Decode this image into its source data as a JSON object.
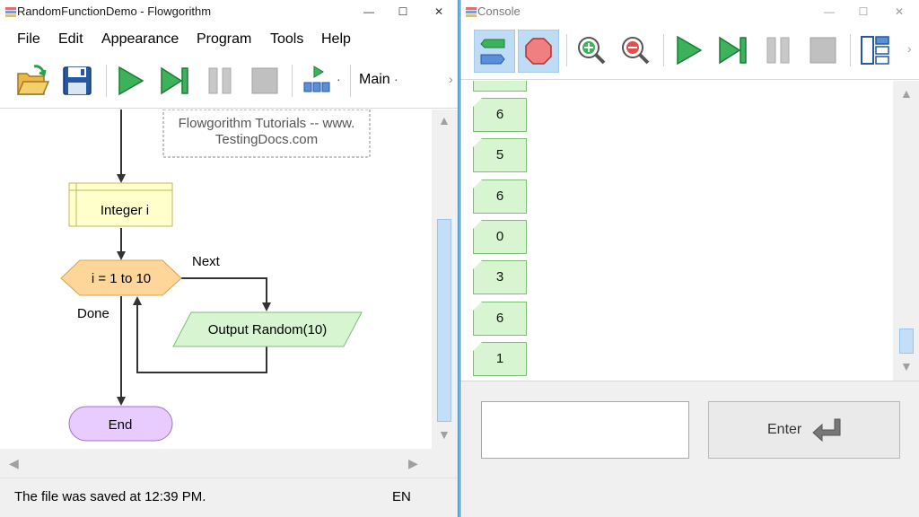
{
  "main_window": {
    "title": "RandomFunctionDemo - Flowgorithm",
    "controls": {
      "minimize": "—",
      "maximize": "☐",
      "close": "✕"
    },
    "menu": [
      "File",
      "Edit",
      "Appearance",
      "Program",
      "Tools",
      "Help"
    ],
    "toolbar": {
      "buttons": [
        "open-folder",
        "save-disk",
        "run",
        "step",
        "pause",
        "stop",
        "layout-run-mode"
      ],
      "function_dropdown": "Main",
      "dropdown_arrow": "·",
      "overflow_arrow": "›"
    },
    "flowchart": {
      "comment": [
        "Flowgorithm Tutorials -- www.",
        "TestingDocs.com"
      ],
      "declare": "Integer i",
      "loop": "i = 1 to 10",
      "loop_next": "Next",
      "loop_done": "Done",
      "output": "Output Random(10)",
      "end": "End"
    },
    "scroll": {
      "up": "▲",
      "down": "▼",
      "left": "◀",
      "right": "▶"
    },
    "status": {
      "message": "The file was saved at 12:39 PM.",
      "language": "EN"
    }
  },
  "console_window": {
    "title": "Console",
    "controls": {
      "minimize": "—",
      "maximize": "☐",
      "close": "✕"
    },
    "toolbar": [
      "chat-view",
      "stop-octagon",
      "zoom-in",
      "zoom-out",
      "run",
      "step",
      "pause",
      "stop",
      "layout"
    ],
    "outputs": [
      "6",
      "5",
      "6",
      "0",
      "3",
      "6",
      "1"
    ],
    "scroll": {
      "up": "▲",
      "down": "▼"
    },
    "input_value": "",
    "enter_label": "Enter"
  },
  "colors": {
    "accent_border": "#2b6cb0",
    "declare_fill": "#ffffcc",
    "loop_fill": "#ffd699",
    "output_fill": "#d6f5d0",
    "end_fill": "#e8ccff",
    "run_green": "#2e9e4f",
    "stop_red": "#f08080",
    "selected_btn": "#bfdcf7"
  }
}
